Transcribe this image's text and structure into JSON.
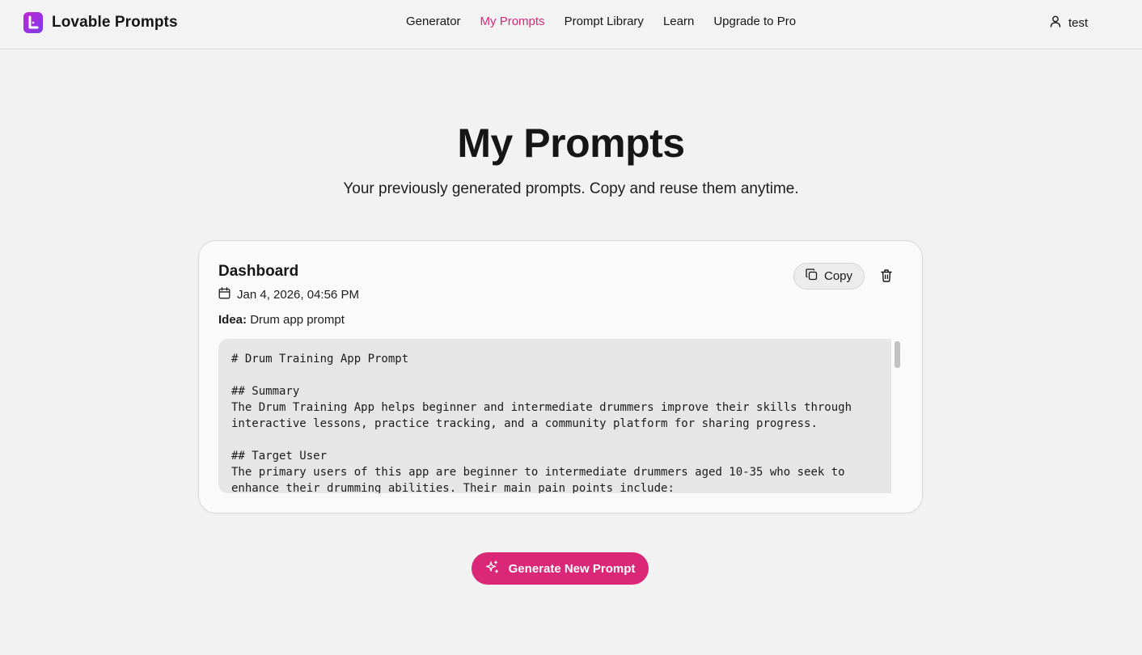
{
  "brand": {
    "name": "Lovable Prompts",
    "logo_letter": "L"
  },
  "nav": {
    "items": [
      {
        "label": "Generator"
      },
      {
        "label": "My Prompts",
        "active": true
      },
      {
        "label": "Prompt Library"
      },
      {
        "label": "Learn"
      },
      {
        "label": "Upgrade to Pro"
      }
    ]
  },
  "user": {
    "name": "test",
    "icon": "user-icon"
  },
  "page": {
    "title": "My Prompts",
    "subtitle": "Your previously generated prompts. Copy and reuse them anytime."
  },
  "card": {
    "title": "Dashboard",
    "date": "Jan 4, 2026, 04:56 PM",
    "idea_label": "Idea:",
    "idea_value": "Drum app prompt",
    "copy_label": "Copy",
    "prompt_text": "# Drum Training App Prompt\n\n## Summary\nThe Drum Training App helps beginner and intermediate drummers improve their skills through\ninteractive lessons, practice tracking, and a community platform for sharing progress.\n\n## Target User\nThe primary users of this app are beginner to intermediate drummers aged 10-35 who seek to\nenhance their drumming abilities. Their main pain points include:"
  },
  "generate_button": {
    "label": "Generate New Prompt",
    "icon": "sparkles-icon"
  },
  "colors": {
    "accent": "#db2777",
    "background": "#f2f2f2",
    "card": "#fafafa"
  }
}
